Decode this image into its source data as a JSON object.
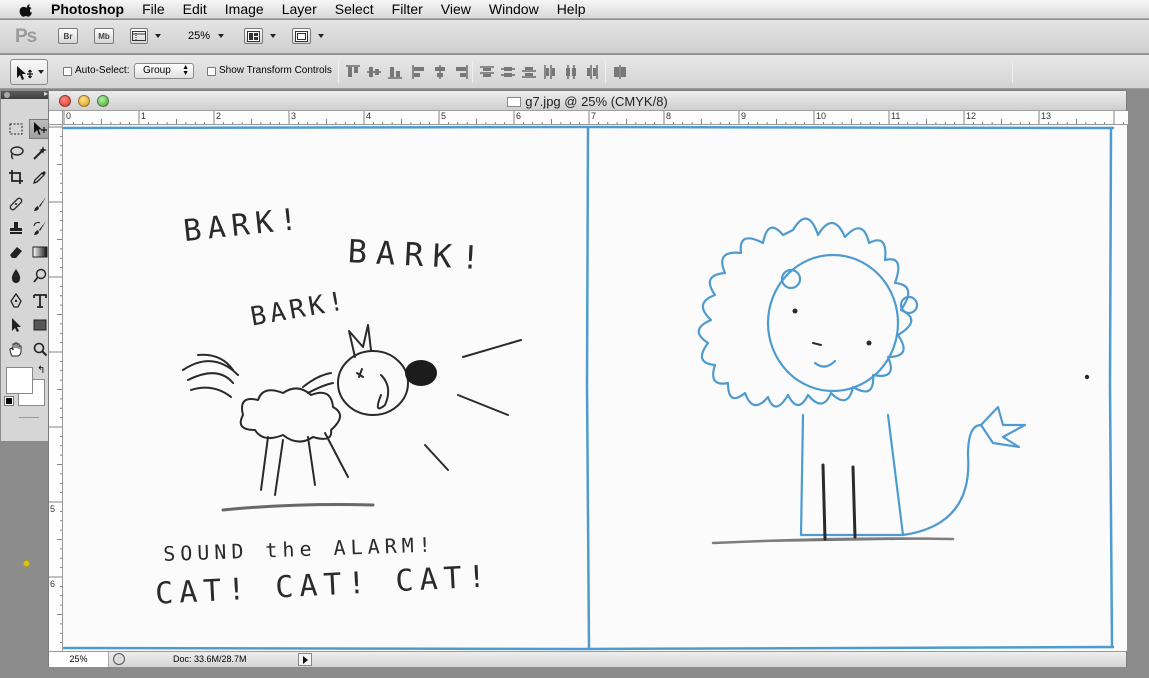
{
  "menubar": {
    "app_name": "Photoshop",
    "items": [
      "File",
      "Edit",
      "Image",
      "Layer",
      "Select",
      "Filter",
      "View",
      "Window",
      "Help"
    ]
  },
  "appbar": {
    "logo": "Ps",
    "bridge_label": "Br",
    "minibridge_label": "Mb",
    "zoom_value": "25%"
  },
  "options": {
    "auto_select_label": "Auto-Select:",
    "auto_select_checked": false,
    "auto_select_target": "Group",
    "show_transform_label": "Show Transform Controls",
    "show_transform_checked": false
  },
  "document": {
    "title": "g7.jpg @ 25% (CMYK/8)",
    "status_zoom": "25%",
    "status_doc": "Doc: 33.6M/28.7M"
  },
  "rulers": {
    "horizontal": [
      "0",
      "1",
      "2",
      "3",
      "4",
      "5",
      "6",
      "7",
      "8",
      "9",
      "10",
      "11",
      "12",
      "13"
    ],
    "vertical": [
      "5",
      "6"
    ]
  },
  "artwork": {
    "panel_left": {
      "words": [
        "BARK!",
        "BARK!",
        "BARK!"
      ],
      "caption_line1": "SOUND the ALARM!",
      "caption_line2": "CAT! CAT! CAT!"
    }
  },
  "colors": {
    "blue_pencil": "#4e9bd0",
    "graphite": "#2a2a2a",
    "accent_dot": "#d8c81c"
  }
}
